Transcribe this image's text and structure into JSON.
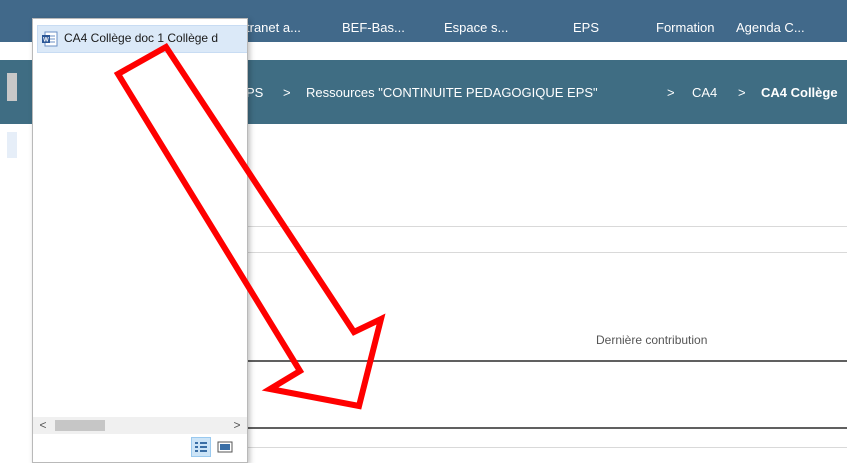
{
  "bookmarks": [
    {
      "label": "tranet a..."
    },
    {
      "label": "BEF-Bas..."
    },
    {
      "label": "Espace s..."
    },
    {
      "label": "EPS"
    },
    {
      "label": "Formation"
    },
    {
      "label": "Agenda C..."
    }
  ],
  "breadcrumb": {
    "items": [
      {
        "label": "PS"
      },
      {
        "label": "Ressources \"CONTINUITE PEDAGOGIQUE EPS\""
      },
      {
        "label": "CA4"
      },
      {
        "label": "CA4 Collège"
      }
    ],
    "separator": ">"
  },
  "table": {
    "column_header": "Dernière contribution"
  },
  "file_panel": {
    "item_label": "CA4 Collège doc 1 Collège d",
    "item_icon": "word-document-icon",
    "view_buttons": [
      "details-view-icon",
      "preview-view-icon"
    ]
  },
  "colors": {
    "bookmarks_bg": "#41698a",
    "breadcrumb_bg": "#3f6d83",
    "arrow_stroke": "#ff0000"
  }
}
